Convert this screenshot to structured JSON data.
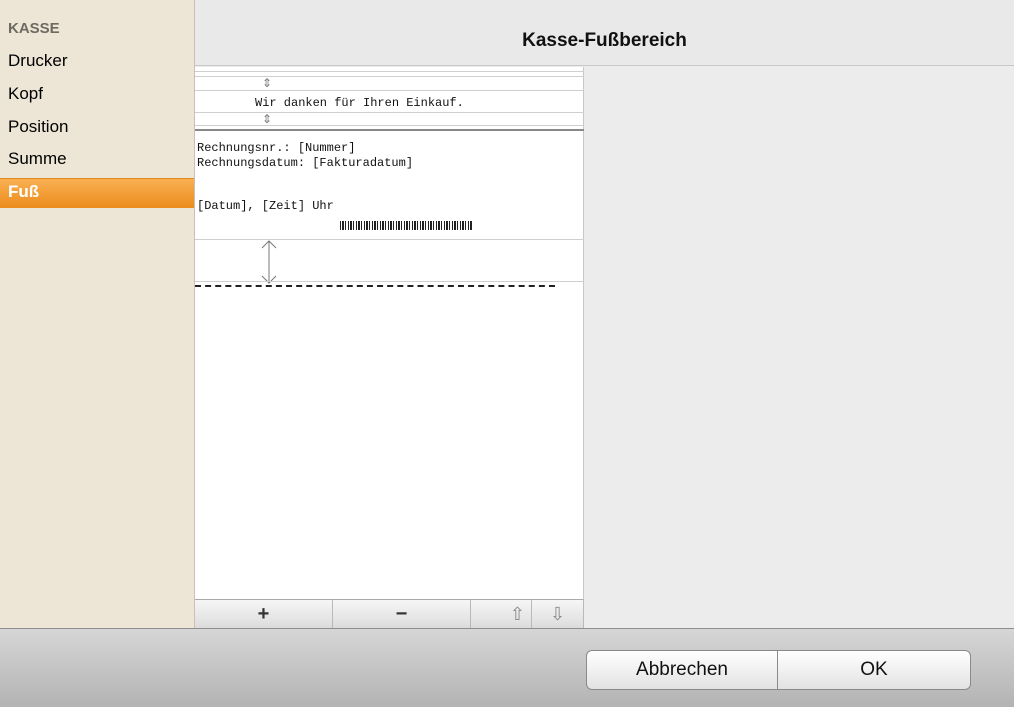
{
  "sidebar": {
    "heading": "KASSE",
    "items": [
      {
        "label": "Drucker"
      },
      {
        "label": "Kopf"
      },
      {
        "label": "Position"
      },
      {
        "label": "Summe"
      },
      {
        "label": "Fuß",
        "selected": true
      }
    ]
  },
  "main": {
    "title": "Kasse-Fußbereich"
  },
  "editor": {
    "header_text": "Wir danken für Ihren Einkauf.",
    "line1": "Rechnungsnr.: [Nummer]",
    "line2": "Rechnungsdatum: [Fakturadatum]",
    "line3": "[Datum], [Zeit] Uhr"
  },
  "toolbar": {
    "add_label": "+",
    "remove_label": "−",
    "up_icon": "⇧",
    "down_icon": "⇩"
  },
  "buttons": {
    "cancel_label": "Abbrechen",
    "ok_label": "OK"
  },
  "colors": {
    "selection": "#ec8c1c",
    "sidebar_bg": "#ede6d6"
  }
}
